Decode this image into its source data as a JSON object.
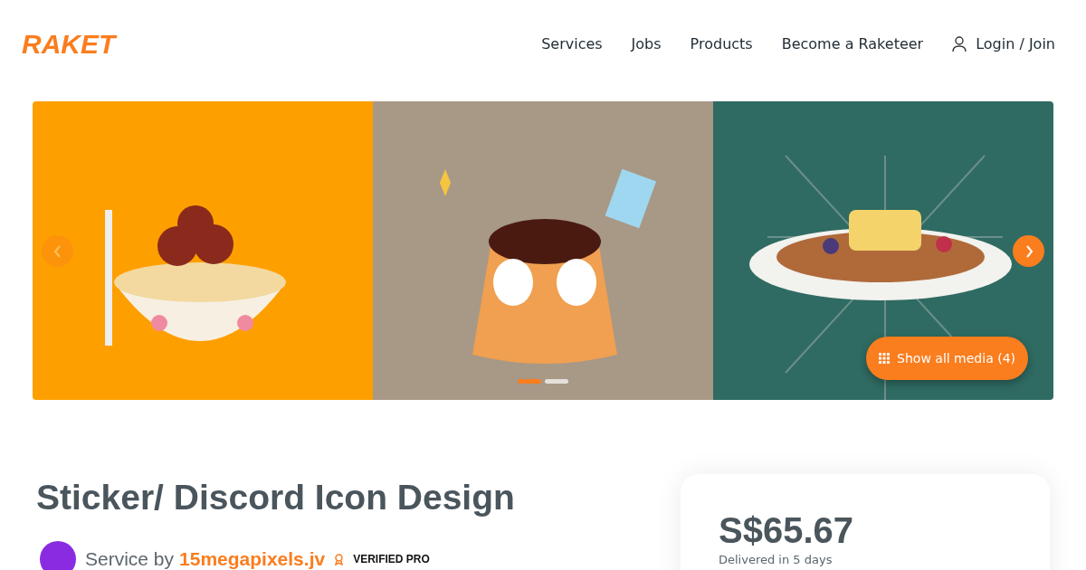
{
  "header": {
    "logo": "RAKET",
    "nav": [
      {
        "label": "Services"
      },
      {
        "label": "Jobs"
      },
      {
        "label": "Products"
      },
      {
        "label": "Become a Raketeer"
      }
    ],
    "login": "Login / Join"
  },
  "gallery": {
    "prev": {
      "disabled": true
    },
    "next": {
      "disabled": false
    },
    "dots": [
      {
        "selected": true
      },
      {
        "selected": false
      }
    ],
    "show_all": "Show all media (4)"
  },
  "service": {
    "title": "Sticker/ Discord Icon Design",
    "by_label": "Service by",
    "seller": "15megapixels.jv",
    "badge": "VERIFIED PRO"
  },
  "price_card": {
    "price": "S$65.67",
    "delivery": "Delivered in 5 days"
  }
}
